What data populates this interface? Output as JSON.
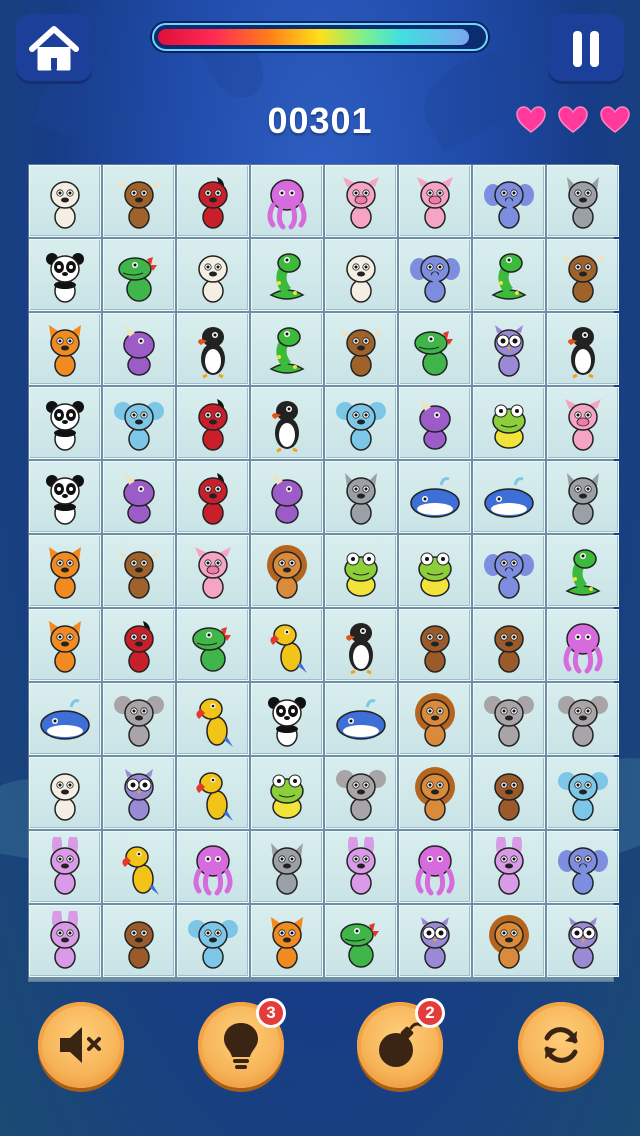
{
  "hud": {
    "score": "00301",
    "lives": 3,
    "time_remaining": 0.96
  },
  "buttons": {
    "hint_count": "3",
    "bomb_count": "2"
  },
  "board": {
    "rows": [
      [
        "sheep",
        "cow",
        "horse",
        "octopus",
        "pig",
        "pig",
        "elephant",
        "wolf"
      ],
      [
        "panda",
        "dinosaur",
        "sheep",
        "snake",
        "sheep",
        "elephant",
        "snake",
        "cow"
      ],
      [
        "fox",
        "rhino",
        "penguin",
        "snake",
        "cow",
        "dinosaur",
        "owl",
        "penguin"
      ],
      [
        "panda",
        "koala",
        "horse",
        "penguin",
        "koala",
        "rhino",
        "frog",
        "pig"
      ],
      [
        "panda",
        "rhino",
        "horse",
        "rhino",
        "wolf",
        "whale",
        "whale",
        "wolf"
      ],
      [
        "fox",
        "cow",
        "pig",
        "lion",
        "frog",
        "frog",
        "elephant",
        "snake"
      ],
      [
        "fox",
        "horse",
        "dinosaur",
        "parrot",
        "penguin",
        "monkey",
        "monkey",
        "octopus"
      ],
      [
        "whale",
        "mouse",
        "parrot",
        "panda",
        "whale",
        "lion",
        "mouse",
        "mouse"
      ],
      [
        "sheep",
        "owl",
        "parrot",
        "frog",
        "mouse",
        "lion",
        "monkey",
        "koala"
      ],
      [
        "rabbit",
        "parrot",
        "octopus",
        "wolf",
        "rabbit",
        "octopus",
        "rabbit",
        "elephant"
      ],
      [
        "rabbit",
        "monkey",
        "koala",
        "fox",
        "dinosaur",
        "owl",
        "lion",
        "owl"
      ]
    ]
  },
  "colors": {
    "sheep": "#f4efe2",
    "cow": "#a0622b",
    "horse": "#c8202a",
    "octopus": "#d56bdc",
    "pig": "#f6a4c4",
    "elephant": "#7d8ee0",
    "wolf": "#9aa0a6",
    "panda": "#ffffff",
    "dinosaur": "#3fb54a",
    "snake": "#3cba3c",
    "fox": "#f28a22",
    "rhino": "#9b5cc7",
    "penguin": "#222222",
    "owl": "#9a8ad6",
    "koala": "#7cc7e8",
    "frog": "#8ccf3a",
    "whale": "#3d6fd6",
    "lion": "#d98a3a",
    "parrot": "#f2c418",
    "monkey": "#9a5a2a",
    "mouse": "#a9a4a8",
    "rabbit": "#d99ae8"
  }
}
